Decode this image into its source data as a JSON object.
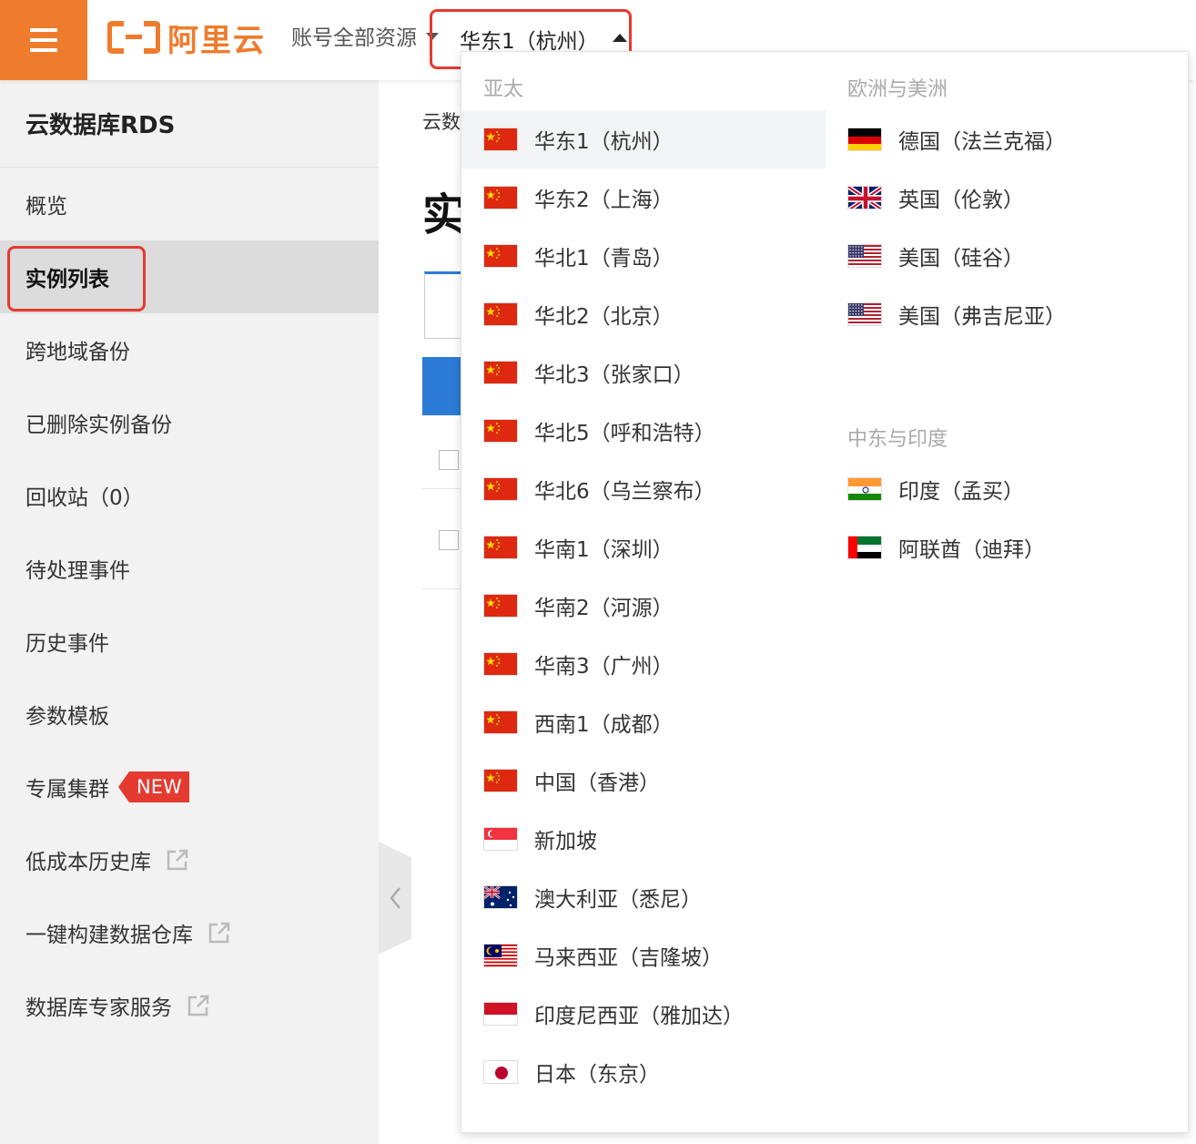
{
  "topbar": {
    "logo_text": "阿里云",
    "account_label": "账号全部资源",
    "region_current": "华东1（杭州）"
  },
  "sidebar": {
    "title": "云数据库RDS",
    "items": [
      {
        "label": "概览"
      },
      {
        "label": "实例列表"
      },
      {
        "label": "跨地域备份"
      },
      {
        "label": "已删除实例备份"
      },
      {
        "label": "回收站（0）"
      },
      {
        "label": "待处理事件"
      },
      {
        "label": "历史事件"
      },
      {
        "label": "参数模板"
      },
      {
        "label": "专属集群",
        "badge": "NEW"
      },
      {
        "label": "低成本历史库"
      },
      {
        "label": "一键构建数据仓库"
      },
      {
        "label": "数据库专家服务"
      }
    ]
  },
  "main": {
    "breadcrumb": "云数",
    "title": "实"
  },
  "dropdown": {
    "asia_pacific": {
      "heading": "亚太",
      "regions": [
        {
          "label": "华东1（杭州）",
          "flag": "cn"
        },
        {
          "label": "华东2（上海）",
          "flag": "cn"
        },
        {
          "label": "华北1（青岛）",
          "flag": "cn"
        },
        {
          "label": "华北2（北京）",
          "flag": "cn"
        },
        {
          "label": "华北3（张家口）",
          "flag": "cn"
        },
        {
          "label": "华北5（呼和浩特）",
          "flag": "cn"
        },
        {
          "label": "华北6（乌兰察布）",
          "flag": "cn"
        },
        {
          "label": "华南1（深圳）",
          "flag": "cn"
        },
        {
          "label": "华南2（河源）",
          "flag": "cn"
        },
        {
          "label": "华南3（广州）",
          "flag": "cn"
        },
        {
          "label": "西南1（成都）",
          "flag": "cn"
        },
        {
          "label": "中国（香港）",
          "flag": "cn"
        },
        {
          "label": "新加坡",
          "flag": "sg"
        },
        {
          "label": "澳大利亚（悉尼）",
          "flag": "au"
        },
        {
          "label": "马来西亚（吉隆坡）",
          "flag": "my"
        },
        {
          "label": "印度尼西亚（雅加达）",
          "flag": "id"
        },
        {
          "label": "日本（东京）",
          "flag": "jp"
        }
      ]
    },
    "europe_americas": {
      "heading": "欧洲与美洲",
      "regions": [
        {
          "label": "德国（法兰克福）",
          "flag": "de"
        },
        {
          "label": "英国（伦敦）",
          "flag": "gb"
        },
        {
          "label": "美国（硅谷）",
          "flag": "us"
        },
        {
          "label": "美国（弗吉尼亚）",
          "flag": "us"
        }
      ]
    },
    "middle_east_india": {
      "heading": "中东与印度",
      "regions": [
        {
          "label": "印度（孟买）",
          "flag": "in"
        },
        {
          "label": "阿联酋（迪拜）",
          "flag": "ae"
        }
      ]
    }
  },
  "colors": {
    "brand_orange": "#ef7b2c",
    "highlight_red": "#e53a30",
    "accent_blue": "#2b7bd6"
  }
}
